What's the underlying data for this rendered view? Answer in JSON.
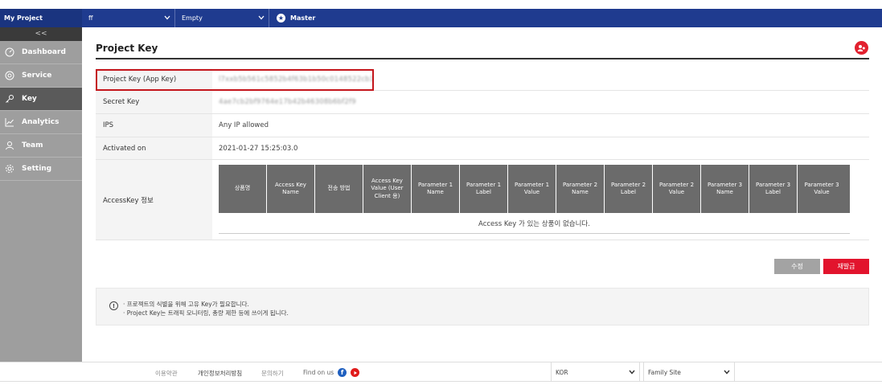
{
  "topbar": {
    "project": "My Project",
    "org_select": "ff",
    "service_select": "Empty",
    "role": "Master"
  },
  "sidebar": {
    "collapse": "<<",
    "items": [
      {
        "label": "Dashboard",
        "icon": "dashboard-icon",
        "active": false
      },
      {
        "label": "Service",
        "icon": "service-icon",
        "active": false
      },
      {
        "label": "Key",
        "icon": "key-icon",
        "active": true
      },
      {
        "label": "Analytics",
        "icon": "analytics-icon",
        "active": false
      },
      {
        "label": "Team",
        "icon": "team-icon",
        "active": false
      },
      {
        "label": "Setting",
        "icon": "gear-icon",
        "active": false
      }
    ]
  },
  "main": {
    "title": "Project Key",
    "rows": {
      "project_key_label": "Project Key (App Key)",
      "project_key_value": "l7xxb5b561c5852b4f63b1b50c0148522cb1",
      "secret_key_label": "Secret Key",
      "secret_key_value": "4ae7cb2bf9764e17b42b46308b6bf2f9",
      "ips_label": "IPS",
      "ips_value": "Any IP allowed",
      "activated_label": "Activated on",
      "activated_value": "2021-01-27 15:25:03.0",
      "accesskey_label": "AccessKey 정보"
    },
    "accesskey_table": {
      "headers": [
        "상품명",
        "Access Key Name",
        "전송 방법",
        "Access Key Value (User Client 용)",
        "Parameter 1 Name",
        "Parameter 1 Label",
        "Parameter 1 Value",
        "Parameter 2 Name",
        "Parameter 2 Label",
        "Parameter 2 Value",
        "Parameter 3 Name",
        "Parameter 3 Label",
        "Parameter 3 Value"
      ],
      "empty_message": "Access Key 가 있는 상품이 없습니다."
    },
    "buttons": {
      "edit": "수정",
      "reissue": "재발급"
    },
    "notice": {
      "lines": [
        "· 프로젝트의 식별을 위해 고유 Key가 필요합니다.",
        "· Project Key는 트래픽 모니터링, 총량 제한 등에 쓰이게 됩니다."
      ]
    }
  },
  "footer": {
    "terms": "이용약관",
    "privacy": "개인정보처리방침",
    "contact": "문의하기",
    "find_us": "Find on us",
    "language": "KOR",
    "family_site": "Family Site"
  },
  "colors": {
    "topbar": "#1f3b8f",
    "sidebar": "#9e9e9e",
    "sidebar_active": "#5a5a5a",
    "highlight": "#c4161c",
    "reissue_button": "#e2142d",
    "edit_button": "#a3a3a3",
    "table_header": "#6b6b6b"
  }
}
